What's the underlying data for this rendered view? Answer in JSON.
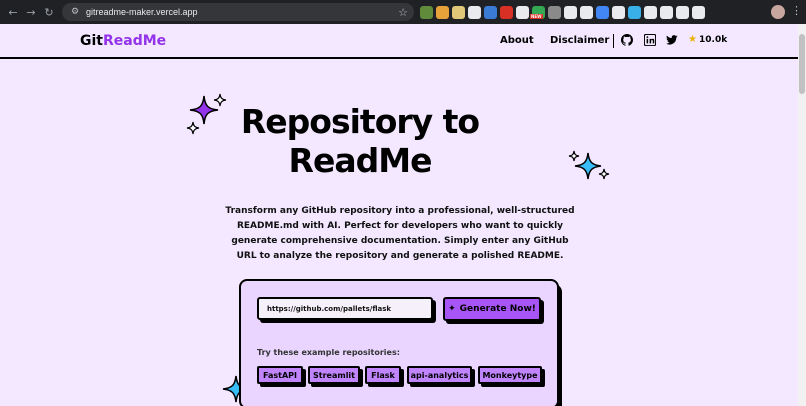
{
  "browser": {
    "url": "gitreadme-maker.vercel.app",
    "nav_back": "←",
    "nav_forward": "→",
    "nav_reload": "↻",
    "url_info_icon": "⚙",
    "bookmark_icon": "☆",
    "menu_icon": "⋮",
    "extension_colors": [
      "#5f8b3a",
      "#e8a23a",
      "#e0c878",
      "#e8eaed",
      "#3a7bd5",
      "#d93025",
      "#e8eaed",
      "#34a853",
      "#8a8a8a",
      "#e8eaed",
      "#e8eaed",
      "#4285f4",
      "#e8eaed",
      "#3ab0e8",
      "#e8eaed",
      "#e8eaed",
      "#e8eaed",
      "#e8eaed"
    ]
  },
  "header": {
    "logo_part1": "Git",
    "logo_part2": "ReadMe",
    "nav_about": "About",
    "nav_disclaimer": "Disclaimer",
    "star_icon": "★",
    "star_count": "10.0k"
  },
  "hero": {
    "title": "Repository to ReadMe",
    "description": "Transform any GitHub repository into a professional, well-structured README.md with AI. Perfect for developers who want to quickly generate comprehensive documentation. Simply enter any GitHub URL to analyze the repository and generate a polished README."
  },
  "form": {
    "repo_url_value": "https://github.com/pallets/flask",
    "generate_icon": "✦",
    "generate_label": "Generate Now!",
    "examples_label": "Try these example repositories:",
    "examples": [
      "FastAPI",
      "Streamlit",
      "Flask",
      "api-analytics",
      "Monkeytype"
    ]
  },
  "colors": {
    "accent": "#9333ea",
    "background": "#f3e8ff",
    "chip": "#c084fc",
    "button": "#a855f7",
    "sparkle_blue": "#38bdf8"
  }
}
